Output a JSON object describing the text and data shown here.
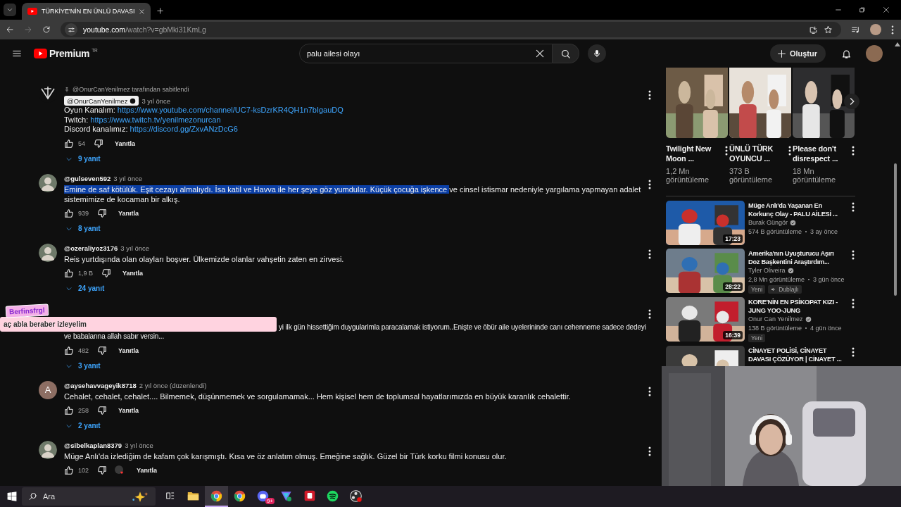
{
  "browser": {
    "tab": {
      "title": "TÜRKİYE'NİN EN ÜNLÜ DAVASI",
      "selected": true
    },
    "url_host": "youtube.com",
    "url_path": "/watch?v=gbMki31KmLg"
  },
  "header": {
    "logo": "Premium",
    "region": "TR",
    "search": {
      "value": "palu ailesi olayı"
    },
    "create_label": "Oluştur"
  },
  "comments": [
    {
      "kind": "pinned",
      "pinned_by": "@OnurCanYenilmez tarafından sabitlendi",
      "author": "@OnurCanYenilmez",
      "owner": true,
      "verified": true,
      "time": "3 yıl önce",
      "lines": [
        {
          "label": "Oyun Kanalım: ",
          "link": "https://www.youtube.com/channel/UC7-ksDzrKR4QH1n7bIgauDQ"
        },
        {
          "label": "Twitch: ",
          "link": "https://www.twitch.tv/yenilmezonurcan"
        },
        {
          "label": "Discord kanalımız: ",
          "link": "https://discord.gg/ZxvANzDcG6"
        }
      ],
      "likes": "54",
      "reply_label": "Yanıtla",
      "replies": "9 yanıt",
      "hearted": false
    },
    {
      "kind": "plain",
      "author": "@gulseven592",
      "owner": false,
      "verified": false,
      "time": "3 yıl önce",
      "segments": [
        {
          "text": "Emine de saf kötülük. Eşit cezayı almalıydı. İsa katil ve Havva ile her şeye göz yumdular. Küçük çocuğa işkence ",
          "selected": true
        },
        {
          "text": "ve cinsel istismar nedeniyle yargılama yapmayan adalet sistemimize de kocaman bir alkış.",
          "selected": false
        }
      ],
      "likes": "939",
      "reply_label": "Yanıtla",
      "replies": "8 yanıt",
      "hearted": false
    },
    {
      "kind": "plain",
      "author": "@ozeraliyoz3176",
      "owner": false,
      "verified": false,
      "time": "3 yıl önce",
      "segments": [
        {
          "text": "Reis yurtdışında olan olayları boşver. Ülkemizde olanlar vahşetin zaten en zirvesi.",
          "selected": false
        }
      ],
      "likes": "1,9 B",
      "reply_label": "Yanıtla",
      "replies": "24 yanıt",
      "hearted": false
    },
    {
      "kind": "partial",
      "lines": [
        "yi ilk gün hissettiğim duygularimla paracalamak istiyorum..Enişte ve öbür aile uyelerininde canı cehenneme sadece dedeyi",
        "ve babalarına allah sabır versin..."
      ],
      "likes": "482",
      "reply_label": "Yanıtla",
      "replies": "3 yanıt",
      "hearted": false
    },
    {
      "kind": "plain",
      "avatar_letter": "A",
      "author": "@aysehavvageyik8718",
      "owner": false,
      "verified": false,
      "time": "2 yıl önce (düzenlendi)",
      "segments": [
        {
          "text": "Cehalet, cehalet, cehalet.... Bilmemek, düşünmemek ve sorgulamamak...  Hem kişisel hem de toplumsal hayatlarımızda en büyük karanlık cehalettir.",
          "selected": false
        }
      ],
      "likes": "258",
      "reply_label": "Yanıtla",
      "replies": "2 yanıt",
      "hearted": false
    },
    {
      "kind": "plain",
      "author": "@sibelkaplan8379",
      "owner": false,
      "verified": false,
      "time": "3 yıl önce",
      "segments": [
        {
          "text": "Müge Anlı'da izlediğim de kafam çok karışmıştı. Kısa ve öz anlatım olmuş. Emeğine sağlık. Güzel bir Türk korku filmi konusu olur.",
          "selected": false
        }
      ],
      "likes": "102",
      "reply_label": "Yanıtla",
      "hearted": true
    }
  ],
  "shorts": [
    {
      "title": "Twilight New Moon ...",
      "views": "1,2 Mn görüntüleme"
    },
    {
      "title": "ÜNLÜ TÜRK OYUNCU ...",
      "views": "373 B görüntüleme"
    },
    {
      "title": "Please don't disrespect ...",
      "views": "18 Mn görüntüleme"
    }
  ],
  "videos": [
    {
      "title": "Müge Anlı'da Yaşanan En Korkunç Olay - PALU AİLESİ ...",
      "channel": "Burak Güngör",
      "verified": true,
      "views": "574 B görüntüleme",
      "age": "3 ay önce",
      "duration": "17:23"
    },
    {
      "title": "Amerika'nın Uyuşturucu Aşırı Doz Başkentini Araştırdım...",
      "channel": "Tyler Oliveira",
      "verified": true,
      "views": "2,8 Mn görüntüleme",
      "age": "3 gün önce",
      "duration": "28:22",
      "badges": [
        {
          "kind": "plain",
          "label": "Yeni"
        },
        {
          "kind": "dubbed",
          "label": "Dublajlı"
        }
      ]
    },
    {
      "title": "KORE'NİN EN PSİKOPAT KIZI - JUNG YOO-JUNG",
      "channel": "Onur Can Yenilmez",
      "verified": true,
      "views": "138 B görüntüleme",
      "age": "4 gün önce",
      "duration": "16:39",
      "badges": [
        {
          "kind": "plain",
          "label": "Yeni"
        }
      ]
    },
    {
      "title": "CİNAYET POLİSİ, CİNAYET DAVASI ÇÖZÜYOR | CİNAYET ..."
    }
  ],
  "chat_overlay": {
    "user": "Berfinsfrgl",
    "message": "aç abla beraber izleyelim"
  },
  "taskbar": {
    "search": {
      "placeholder": "Ara"
    },
    "apps": [
      {
        "kind": "task-view",
        "active": false
      },
      {
        "kind": "folder",
        "active": false
      },
      {
        "kind": "browser",
        "active": true
      },
      {
        "kind": "browser",
        "active": false
      },
      {
        "kind": "chat",
        "active": false,
        "badge": "9+"
      },
      {
        "kind": "triangle",
        "active": false
      },
      {
        "kind": "red-square",
        "active": false
      },
      {
        "kind": "music",
        "active": false
      },
      {
        "kind": "recorder",
        "active": false
      }
    ]
  }
}
